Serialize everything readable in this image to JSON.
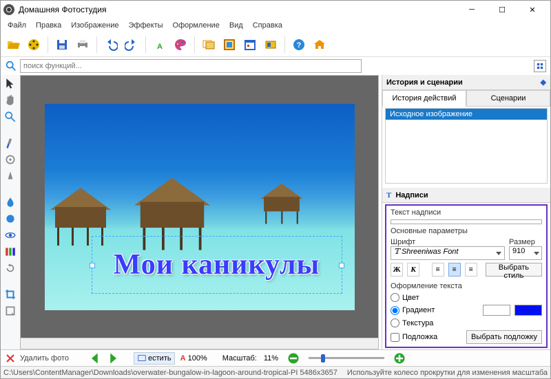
{
  "window": {
    "title": "Домашняя Фотостудия"
  },
  "menu": {
    "file": "Файл",
    "edit": "Правка",
    "image": "Изображение",
    "effects": "Эффекты",
    "design": "Оформление",
    "view": "Вид",
    "help": "Справка"
  },
  "search": {
    "placeholder": "поиск функций..."
  },
  "right": {
    "history_title": "История и сценарии",
    "tab_history": "История действий",
    "tab_scenarios": "Сценарии",
    "hist_item": "Исходное изображение",
    "captions_title": "Надписи",
    "text_label": "Текст надписи",
    "text_value": "Мои каникулы",
    "params_label": "Основные параметры",
    "font_label": "Шрифт",
    "font_value": "Shreeniwas Font",
    "size_label": "Размер",
    "size_value": "910",
    "bold": "Ж",
    "italic": "К",
    "style_btn": "Выбрать стиль",
    "design_label": "Оформление текста",
    "opt_color": "Цвет",
    "opt_gradient": "Градиент",
    "opt_texture": "Текстура",
    "opt_underlay": "Подложка",
    "underlay_btn": "Выбрать подложку",
    "gradient_c1": "#ffffff",
    "gradient_c2": "#0010f0"
  },
  "canvas": {
    "big_text": "Мои каникулы"
  },
  "bottom": {
    "delete": "Удалить фото",
    "fit": "естить",
    "zoom100": "100%",
    "zoom100_prefix": "A",
    "zoom_label": "Масштаб:",
    "zoom_value": "11%"
  },
  "status": {
    "left": "C:\\Users\\ContentManager\\Downloads\\overwater-bungalow-in-lagoon-around-tropical-PI 5486x3657",
    "right": "Используйте колесо прокрутки для изменения масштаба"
  }
}
